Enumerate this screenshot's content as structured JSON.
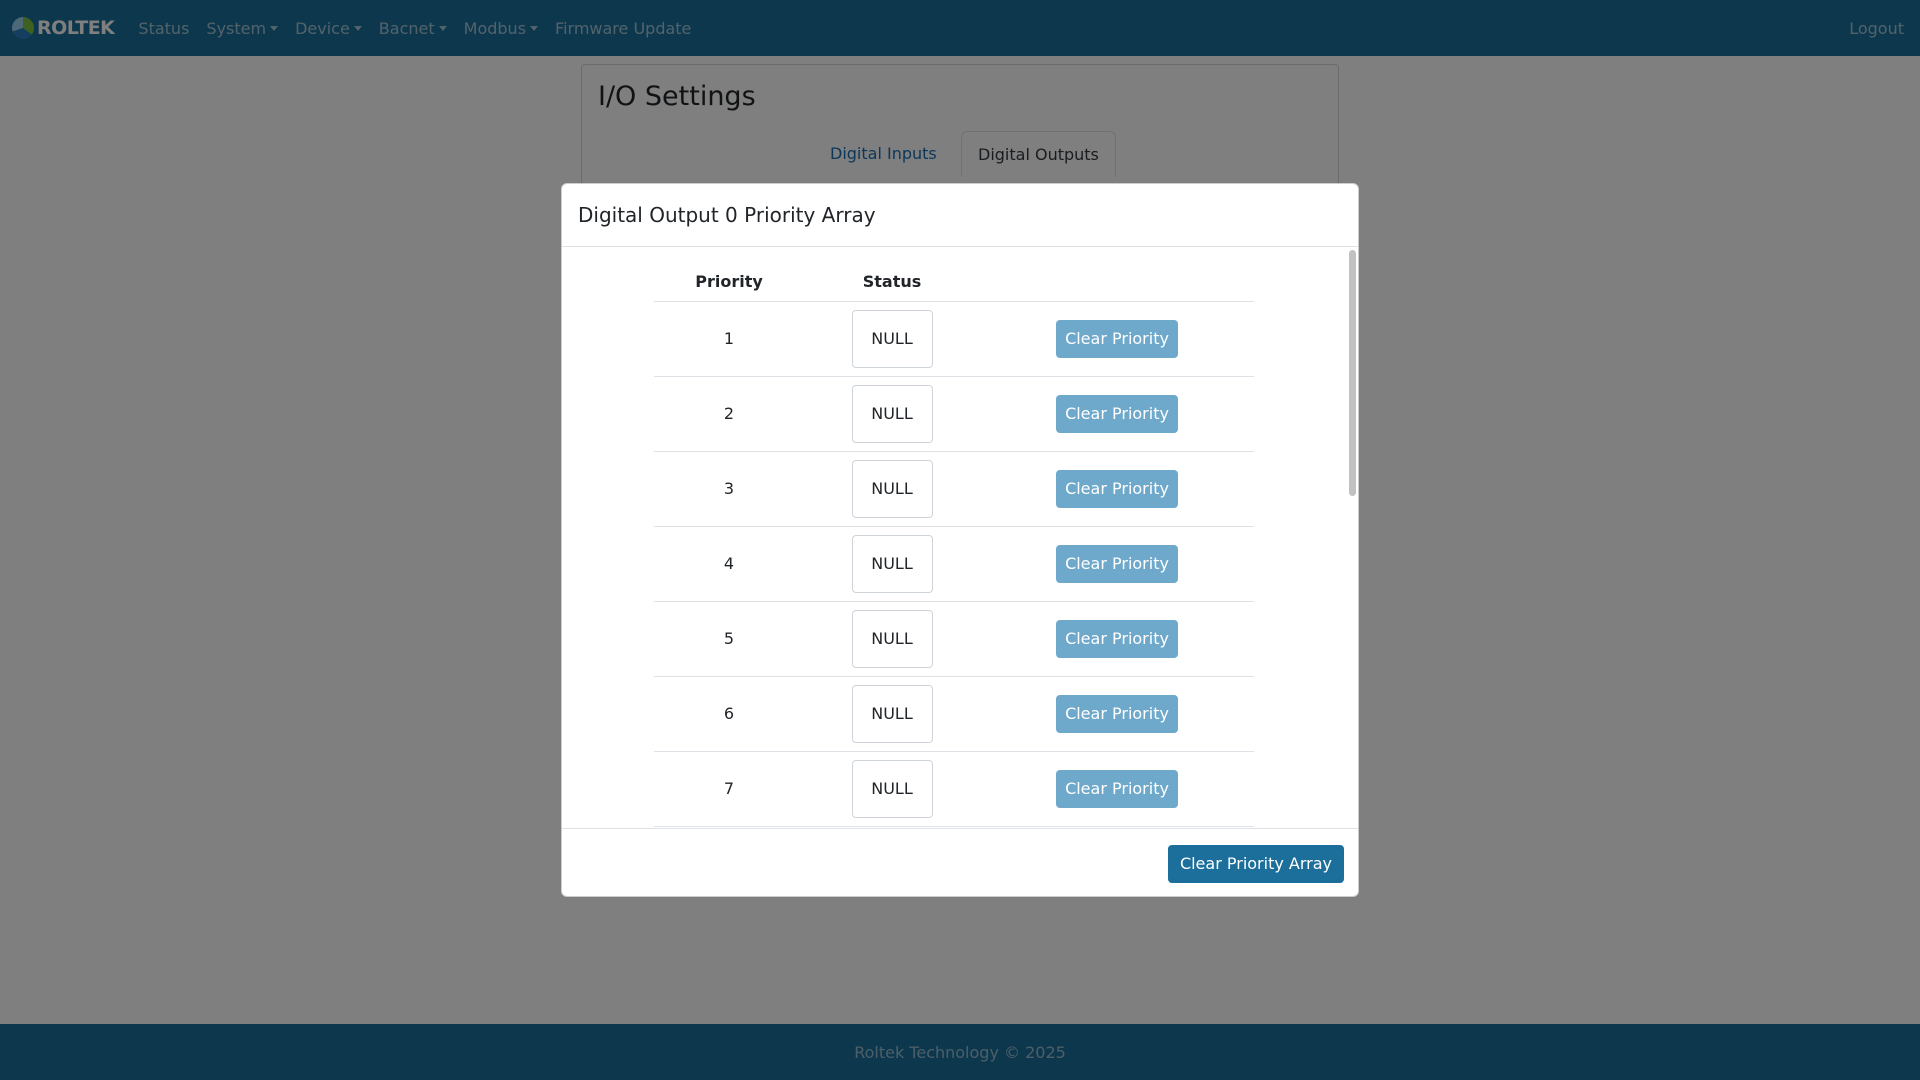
{
  "navbar": {
    "brand": "ROLTEK",
    "items": [
      {
        "label": "Status"
      },
      {
        "label": "System"
      },
      {
        "label": "Device"
      },
      {
        "label": "Bacnet"
      },
      {
        "label": "Modbus"
      },
      {
        "label": "Firmware Update"
      }
    ],
    "logout": "Logout"
  },
  "page": {
    "title": "I/O Settings",
    "tabs": [
      {
        "label": "Digital Inputs"
      },
      {
        "label": "Digital Outputs"
      }
    ]
  },
  "modal": {
    "title": "Digital Output 0 Priority Array",
    "columns": {
      "priority": "Priority",
      "status": "Status"
    },
    "rows": [
      {
        "priority": "1",
        "status": "NULL",
        "action": "Clear Priority"
      },
      {
        "priority": "2",
        "status": "NULL",
        "action": "Clear Priority"
      },
      {
        "priority": "3",
        "status": "NULL",
        "action": "Clear Priority"
      },
      {
        "priority": "4",
        "status": "NULL",
        "action": "Clear Priority"
      },
      {
        "priority": "5",
        "status": "NULL",
        "action": "Clear Priority"
      },
      {
        "priority": "6",
        "status": "NULL",
        "action": "Clear Priority"
      },
      {
        "priority": "7",
        "status": "NULL",
        "action": "Clear Priority"
      }
    ],
    "clear_all": "Clear Priority Array"
  },
  "footer": {
    "text": "Roltek Technology © 2025"
  },
  "colors": {
    "navbar": "#1b6f9a",
    "primary_button": "#1b6f9a",
    "clear_button": "#6ea9cc"
  }
}
